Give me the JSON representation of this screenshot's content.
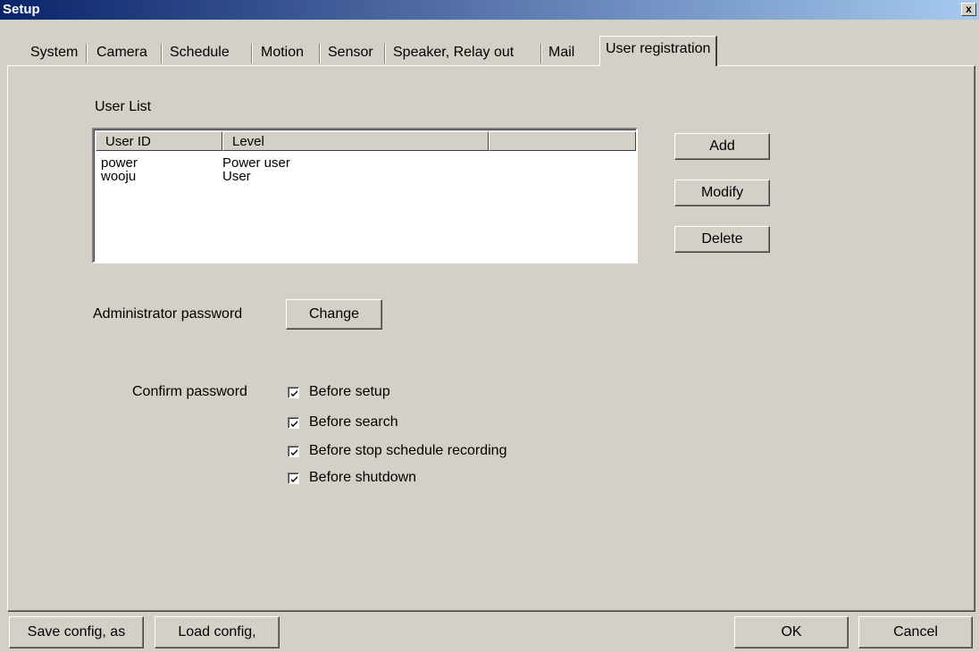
{
  "window": {
    "title": "Setup",
    "close_label": "x"
  },
  "tabs": [
    {
      "label": "System"
    },
    {
      "label": "Camera"
    },
    {
      "label": "Schedule"
    },
    {
      "label": "Motion"
    },
    {
      "label": "Sensor"
    },
    {
      "label": "Speaker, Relay out"
    },
    {
      "label": "Mail"
    },
    {
      "label": "User registration",
      "active": true
    }
  ],
  "user_list": {
    "heading": "User List",
    "columns": [
      "User ID",
      "Level",
      ""
    ],
    "rows": [
      {
        "user_id": "power",
        "level": "Power user"
      },
      {
        "user_id": "wooju",
        "level": "User"
      }
    ],
    "buttons": {
      "add": "Add",
      "modify": "Modify",
      "delete": "Delete"
    }
  },
  "admin_password": {
    "label": "Administrator password",
    "button": "Change"
  },
  "confirm_password": {
    "label": "Confirm password",
    "options": [
      {
        "label": "Before setup",
        "checked": true
      },
      {
        "label": "Before search",
        "checked": true
      },
      {
        "label": "Before stop schedule recording",
        "checked": true
      },
      {
        "label": "Before shutdown",
        "checked": true
      }
    ]
  },
  "footer": {
    "save_config": "Save config, as",
    "load_config": "Load config,",
    "ok": "OK",
    "cancel": "Cancel"
  }
}
